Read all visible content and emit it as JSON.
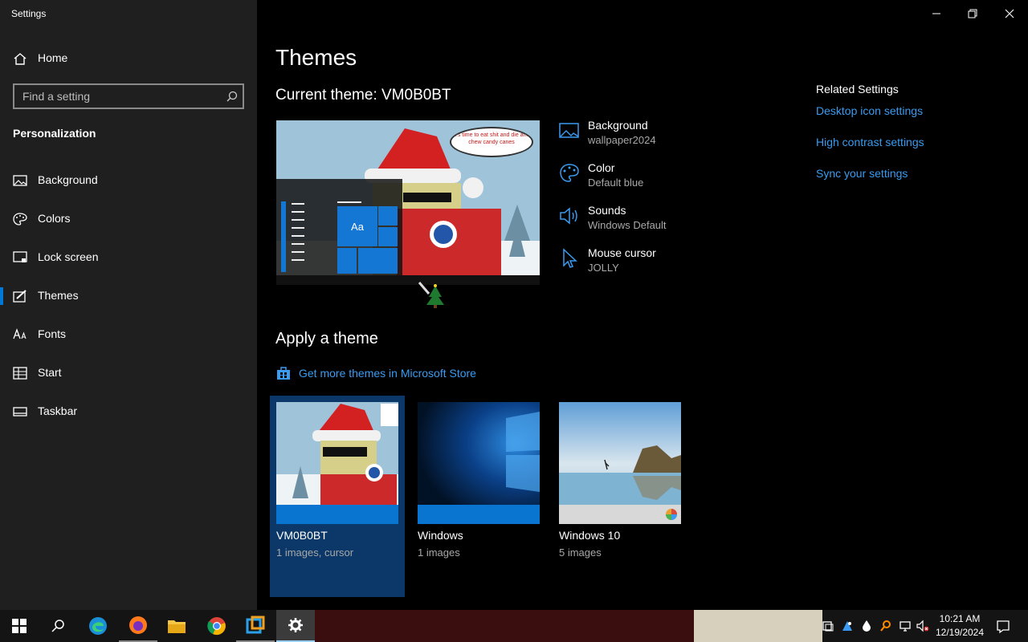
{
  "window": {
    "title": "Settings"
  },
  "sidebar": {
    "home_label": "Home",
    "search_placeholder": "Find a setting",
    "section_title": "Personalization",
    "items": [
      {
        "label": "Background",
        "icon": "picture-icon"
      },
      {
        "label": "Colors",
        "icon": "palette-icon"
      },
      {
        "label": "Lock screen",
        "icon": "lock-screen-icon"
      },
      {
        "label": "Themes",
        "icon": "brush-icon",
        "selected": true
      },
      {
        "label": "Fonts",
        "icon": "font-icon"
      },
      {
        "label": "Start",
        "icon": "start-icon"
      },
      {
        "label": "Taskbar",
        "icon": "taskbar-icon"
      }
    ]
  },
  "main": {
    "title": "Themes",
    "current_theme_label": "Current theme: VM0B0BT",
    "preview": {
      "speech_bubble": "It's time to eat shit and die and chew candy canes",
      "tile_label": "Aa"
    },
    "properties": [
      {
        "title": "Background",
        "value": "wallpaper2024",
        "icon": "picture-icon"
      },
      {
        "title": "Color",
        "value": "Default blue",
        "icon": "palette-icon"
      },
      {
        "title": "Sounds",
        "value": "Windows Default",
        "icon": "speaker-icon"
      },
      {
        "title": "Mouse cursor",
        "value": "JOLLY",
        "icon": "cursor-icon"
      }
    ],
    "apply_heading": "Apply a theme",
    "store_link": "Get more themes in Microsoft Store",
    "themes": [
      {
        "name": "VM0B0BT",
        "count": "1 images, cursor",
        "selected": true
      },
      {
        "name": "Windows",
        "count": "1 images"
      },
      {
        "name": "Windows 10",
        "count": "5 images"
      }
    ]
  },
  "related": {
    "heading": "Related Settings",
    "links": [
      "Desktop icon settings",
      "High contrast settings",
      "Sync your settings"
    ]
  },
  "taskbar": {
    "apps": [
      "start-icon",
      "search-icon",
      "edge-icon",
      "firefox-icon",
      "file-explorer-icon",
      "chrome-icon",
      "app-icon",
      "settings-icon"
    ],
    "clock_time": "10:21 AM",
    "clock_date": "12/19/2024"
  },
  "colors": {
    "accent": "#0078d7",
    "link": "#3a9bf0",
    "sidebar_bg": "#1f1f1f"
  }
}
